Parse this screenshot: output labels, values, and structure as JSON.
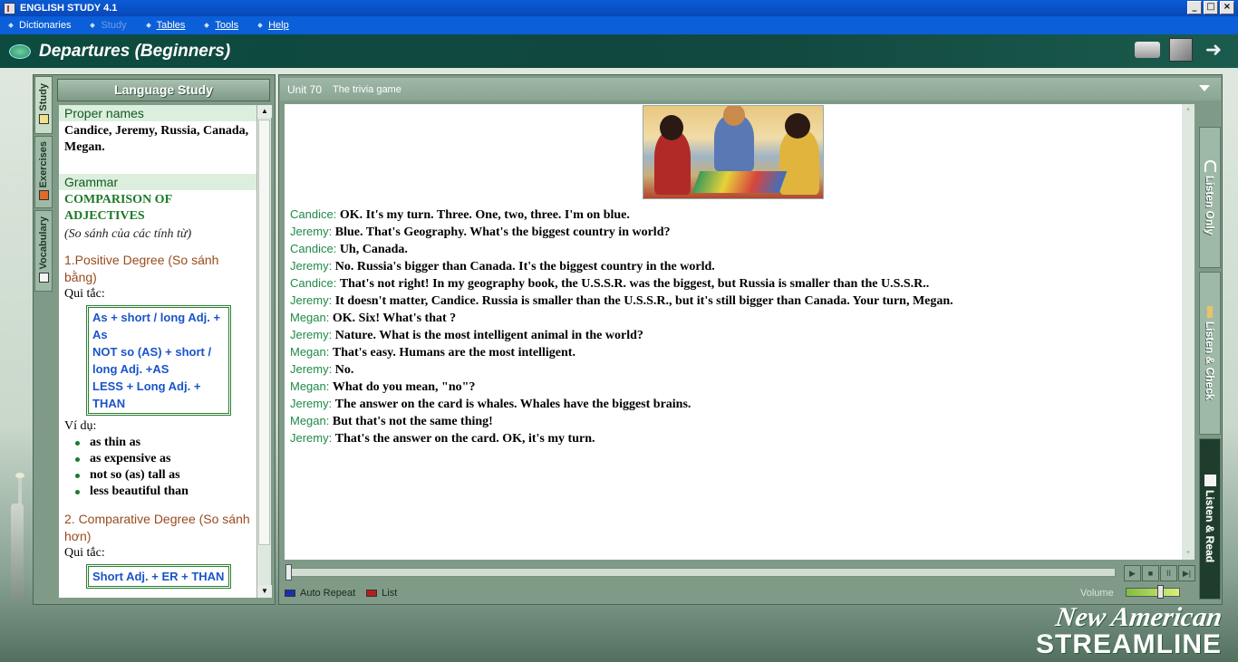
{
  "window": {
    "title": "ENGLISH STUDY 4.1",
    "minimize": "_",
    "restore": "□",
    "close": "×"
  },
  "menu": [
    {
      "label": "Dictionaries",
      "enabled": true
    },
    {
      "label": "Study",
      "enabled": false
    },
    {
      "label": "Tables",
      "enabled": true
    },
    {
      "label": "Tools",
      "enabled": true
    },
    {
      "label": "Help",
      "enabled": true
    }
  ],
  "header": {
    "title": "Departures (Beginners)",
    "icons": [
      "printer-icon",
      "cd-icon",
      "next-arrow-icon"
    ],
    "next_glyph": "➜"
  },
  "left_tabs": [
    {
      "label": "Study",
      "icon": "study-icon",
      "active": true
    },
    {
      "label": "Exercises",
      "icon": "exercises-icon",
      "active": false
    },
    {
      "label": "Vocabulary",
      "icon": "vocabulary-icon",
      "active": false
    }
  ],
  "language_study": {
    "title": "Language Study",
    "proper_names": {
      "heading": "Proper names",
      "text": "Candice, Jeremy, Russia, Canada, Megan."
    },
    "grammar": {
      "heading": "Grammar",
      "topic": "COMPARISON OF ADJECTIVES",
      "topic_vi": "(So sánh của các tính từ)",
      "positive": {
        "heading": "1.Positive Degree (So sánh bằng)",
        "rule_label": "Qui tắc:",
        "rules": [
          "As + short / long Adj. + As",
          "NOT so (AS) + short / long Adj. +AS",
          "LESS + Long Adj. + THAN"
        ],
        "example_label": "Ví dụ:",
        "examples": [
          "as thin as",
          "as expensive as",
          "not so (as) tall as",
          "less beautiful than"
        ]
      },
      "comparative": {
        "heading": "2. Comparative Degree (So sánh hơn)",
        "rule_label": "Qui tắc:",
        "rules": [
          "Short Adj. + ER + THAN"
        ]
      }
    },
    "scroll_up": "▲",
    "scroll_down": "▼"
  },
  "unit": {
    "number": "Unit 70",
    "title": "The trivia game"
  },
  "dialogue": [
    {
      "speaker": "Candice:",
      "text": "OK. It's my turn. Three. One, two, three. I'm on blue."
    },
    {
      "speaker": "Jeremy:",
      "text": "Blue. That's Geography. What's the biggest country in world?"
    },
    {
      "speaker": "Candice:",
      "text": "Uh, Canada."
    },
    {
      "speaker": "Jeremy:",
      "text": "No. Russia's bigger than Canada. It's the biggest country in the world."
    },
    {
      "speaker": "Candice:",
      "text": "That's not right! In my geography book, the U.S.S.R. was the biggest, but Russia is smaller than the U.S.S.R.."
    },
    {
      "speaker": "Jeremy:",
      "text": "It doesn't matter, Candice. Russia is smaller than the U.S.S.R., but it's still bigger than Canada. Your turn, Megan."
    },
    {
      "speaker": "Megan:",
      "text": "OK. Six! What's that ?"
    },
    {
      "speaker": "Jeremy:",
      "text": "Nature. What is the most intelligent animal in the world?"
    },
    {
      "speaker": "Megan:",
      "text": "That's easy. Humans are the most intelligent."
    },
    {
      "speaker": "Jeremy:",
      "text": "No."
    },
    {
      "speaker": "Megan:",
      "text": "What do you mean, \"no\"?"
    },
    {
      "speaker": "Jeremy:",
      "text": "The answer on the card is whales. Whales have the biggest brains."
    },
    {
      "speaker": "Megan:",
      "text": "But that's not the same thing!"
    },
    {
      "speaker": "Jeremy:",
      "text": "That's the answer on the card. OK, it's my turn."
    }
  ],
  "right_tabs": [
    {
      "label": "Listen Only",
      "icon": "headphones-icon",
      "active": false
    },
    {
      "label": "Listen & Check",
      "icon": "pencil-icon",
      "active": false
    },
    {
      "label": "Listen & Read",
      "icon": "book-icon",
      "active": true
    }
  ],
  "player": {
    "buttons": [
      {
        "name": "play-button",
        "glyph": "▶"
      },
      {
        "name": "stop-button",
        "glyph": "■"
      },
      {
        "name": "pause-button",
        "glyph": "II"
      },
      {
        "name": "step-button",
        "glyph": "▶|"
      }
    ],
    "auto_repeat": "Auto Repeat",
    "list": "List",
    "volume_label": "Volume",
    "volume_level": 0.65,
    "position": 0.0
  },
  "brand": {
    "line1": "New American",
    "line2": "STREAMLINE"
  },
  "colors": {
    "accent": "#0b5fd8",
    "speaker": "#1f8a47",
    "rule_text": "#1a54c9",
    "heading_brown": "#9a4a1e"
  }
}
